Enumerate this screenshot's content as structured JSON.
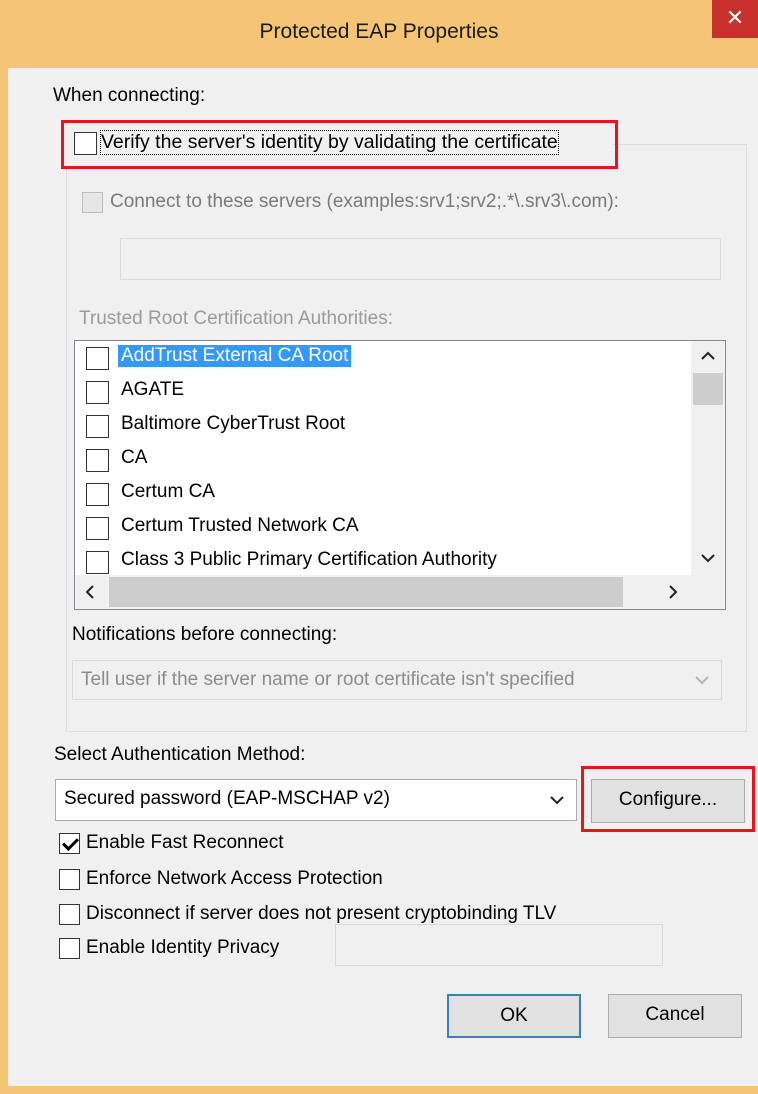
{
  "window": {
    "title": "Protected EAP Properties",
    "close_glyph": "✕"
  },
  "connecting": {
    "heading": "When connecting:",
    "verify_label": "Verify the server's identity by validating the certificate",
    "verify_checked": false,
    "connect_servers_label": "Connect to these servers (examples:srv1;srv2;.*\\.srv3\\.com):",
    "connect_servers_value": "",
    "trusted_root_label": "Trusted Root Certification Authorities:",
    "ca_list": [
      {
        "name": "AddTrust External CA Root",
        "checked": false,
        "selected": true
      },
      {
        "name": "AGATE",
        "checked": false,
        "selected": false
      },
      {
        "name": "Baltimore CyberTrust Root",
        "checked": false,
        "selected": false
      },
      {
        "name": "CA",
        "checked": false,
        "selected": false
      },
      {
        "name": "Certum CA",
        "checked": false,
        "selected": false
      },
      {
        "name": "Certum Trusted Network CA",
        "checked": false,
        "selected": false
      },
      {
        "name": "Class 3 Public Primary Certification Authority",
        "checked": false,
        "selected": false
      }
    ],
    "notifications_label": "Notifications before connecting:",
    "notifications_value": "Tell user if the server name or root certificate isn't specified"
  },
  "auth": {
    "heading": "Select Authentication Method:",
    "method_value": "Secured password (EAP-MSCHAP v2)",
    "configure_label": "Configure...",
    "options": [
      {
        "label": "Enable Fast Reconnect",
        "checked": true
      },
      {
        "label": "Enforce Network Access Protection",
        "checked": false
      },
      {
        "label": "Disconnect if server does not present cryptobinding TLV",
        "checked": false
      },
      {
        "label": "Enable Identity Privacy",
        "checked": false
      }
    ],
    "identity_privacy_value": ""
  },
  "buttons": {
    "ok_label": "OK",
    "cancel_label": "Cancel"
  },
  "colors": {
    "titlebar": "#f5c575",
    "close": "#c7302b",
    "highlight_box": "#e8141c",
    "selection": "#3399ff"
  },
  "icons": {
    "close": "close-icon",
    "scroll_up": "chevron-up-icon",
    "scroll_down": "chevron-down-icon",
    "scroll_left": "chevron-left-icon",
    "scroll_right": "chevron-right-icon",
    "dropdown": "chevron-down-icon",
    "check": "checkmark-icon"
  }
}
